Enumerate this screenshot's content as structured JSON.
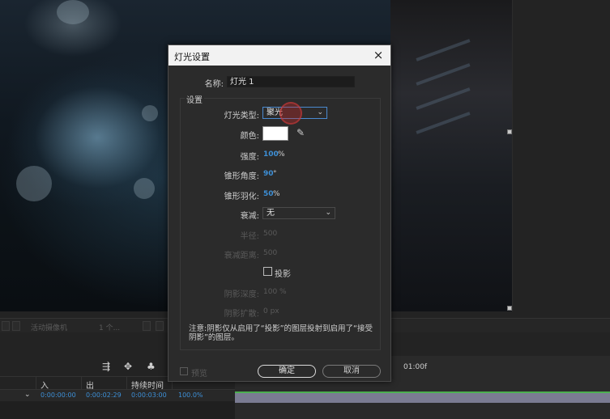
{
  "dialog": {
    "title": "灯光设置",
    "close_glyph": "×",
    "name_label": "名称:",
    "name_value": "灯光 1",
    "group_label": "设置",
    "light_type_label": "灯光类型:",
    "light_type_value": "聚光",
    "color_label": "颜色:",
    "color_value": "#ffffff",
    "intensity_label": "强度:",
    "intensity_value": "100",
    "intensity_unit": "%",
    "cone_angle_label": "锥形角度:",
    "cone_angle_value": "90",
    "cone_angle_unit": "°",
    "cone_feather_label": "锥形羽化:",
    "cone_feather_value": "50",
    "cone_feather_unit": "%",
    "falloff_label": "衰减:",
    "falloff_value": "无",
    "radius_label": "半径:",
    "radius_value": "500",
    "falloff_distance_label": "衰减距离:",
    "falloff_distance_value": "500",
    "shadow_label": "投影",
    "shadow_darkness_label": "阴影深度:",
    "shadow_darkness_value": "100 %",
    "shadow_diffusion_label": "阴影扩散:",
    "shadow_diffusion_value": "0 px",
    "note": "注意:阴影仅从启用了“投影”的图层投射到启用了“接受阴影”的图层。",
    "preview_label": "预览",
    "ok_label": "确定",
    "cancel_label": "取消"
  },
  "viewer_toolbar": {
    "camera_label": "活动摄像机",
    "views_label": "1 个..."
  },
  "timeline": {
    "col_in": "入",
    "col_out": "出",
    "col_duration": "持续时间",
    "row_in": "0:00:00:00",
    "row_out": "0:00:02:29",
    "row_duration": "0:00:03:00",
    "row_stretch": "100.0%",
    "ruler_label": "01:00f"
  },
  "icons": {
    "close": "close-icon",
    "chevron": "chevron-down-icon",
    "eyedropper": "eyedropper-icon"
  },
  "colors": {
    "accent_blue": "#3d8fd6",
    "track_green": "#4caf50"
  }
}
